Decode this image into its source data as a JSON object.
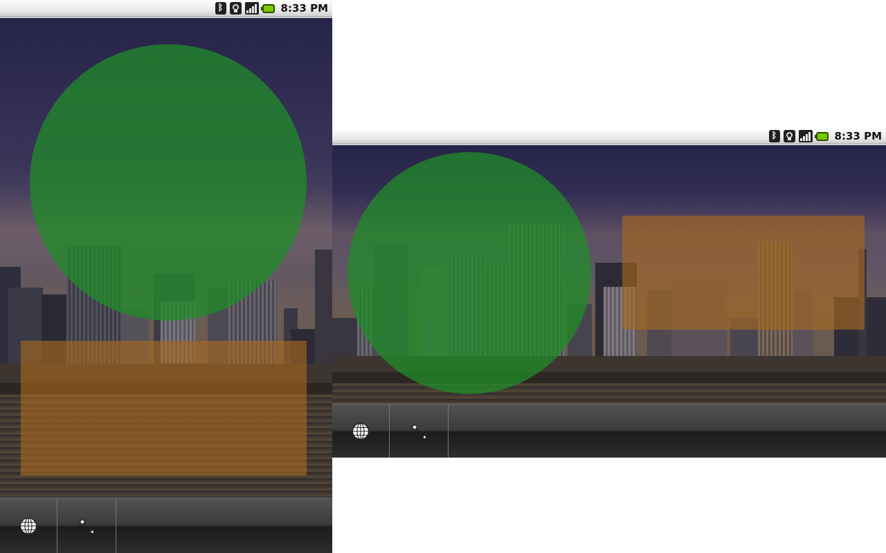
{
  "status_bar": {
    "time": "8:33 PM",
    "icons": [
      "bluetooth-icon",
      "wifi-icon",
      "signal-icon",
      "battery-icon"
    ],
    "battery_color": "#78c800"
  },
  "overlays": {
    "circle_color": "#208c28",
    "rect_color": "#aa691e"
  },
  "bottom_bar": {
    "buttons": [
      {
        "icon": "globe-icon"
      },
      {
        "icon": "wrench-icon"
      }
    ]
  },
  "devices": [
    {
      "orientation": "portrait"
    },
    {
      "orientation": "landscape"
    }
  ]
}
